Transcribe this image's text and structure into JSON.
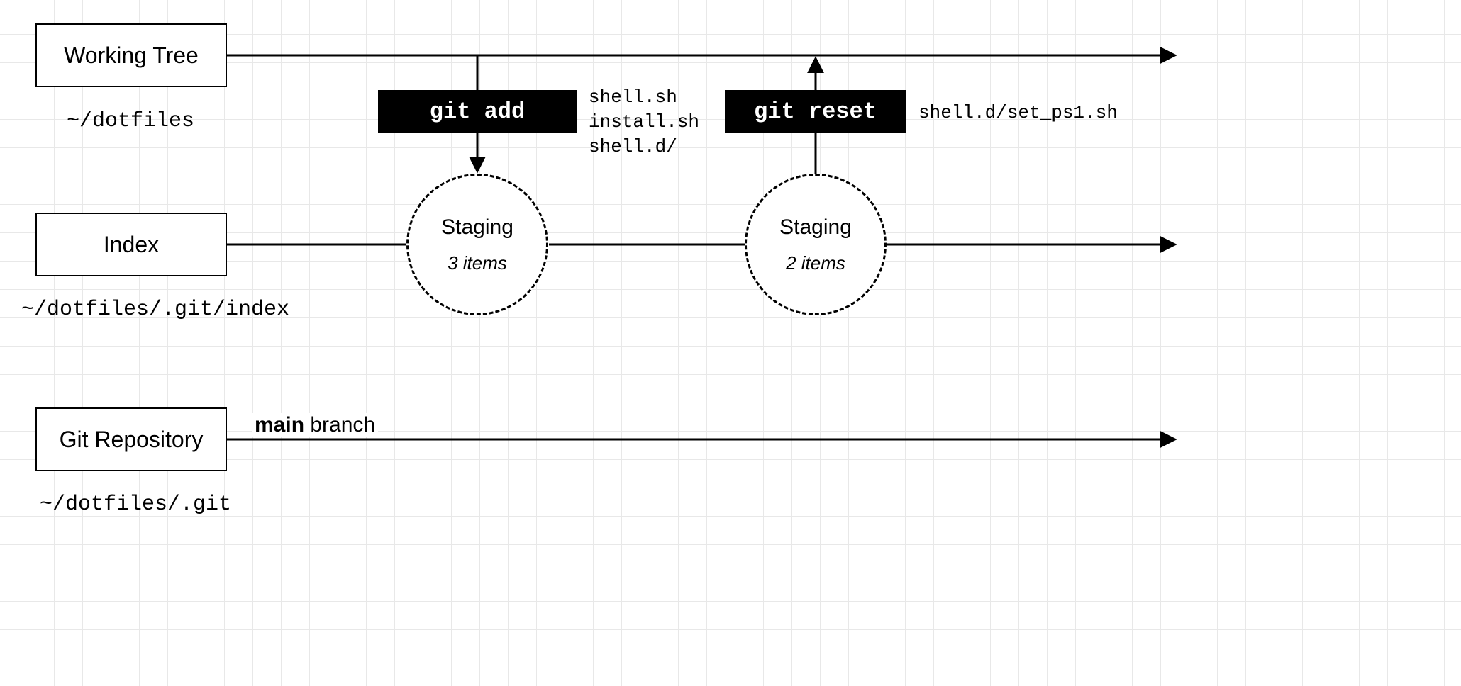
{
  "rows": {
    "working_tree": {
      "label": "Working Tree",
      "path": "~/dotfiles"
    },
    "index": {
      "label": "Index",
      "path": "~/dotfiles/.git/index"
    },
    "repo": {
      "label": "Git Repository",
      "path": "~/dotfiles/.git"
    }
  },
  "commands": {
    "add": {
      "label": "git add",
      "files": "shell.sh\ninstall.sh\nshell.d/"
    },
    "reset": {
      "label": "git reset",
      "files": "shell.d/set_ps1.sh"
    }
  },
  "staging": {
    "a": {
      "title": "Staging",
      "count": "3 items"
    },
    "b": {
      "title": "Staging",
      "count": "2 items"
    }
  },
  "branch": {
    "name": "main",
    "suffix": " branch"
  }
}
